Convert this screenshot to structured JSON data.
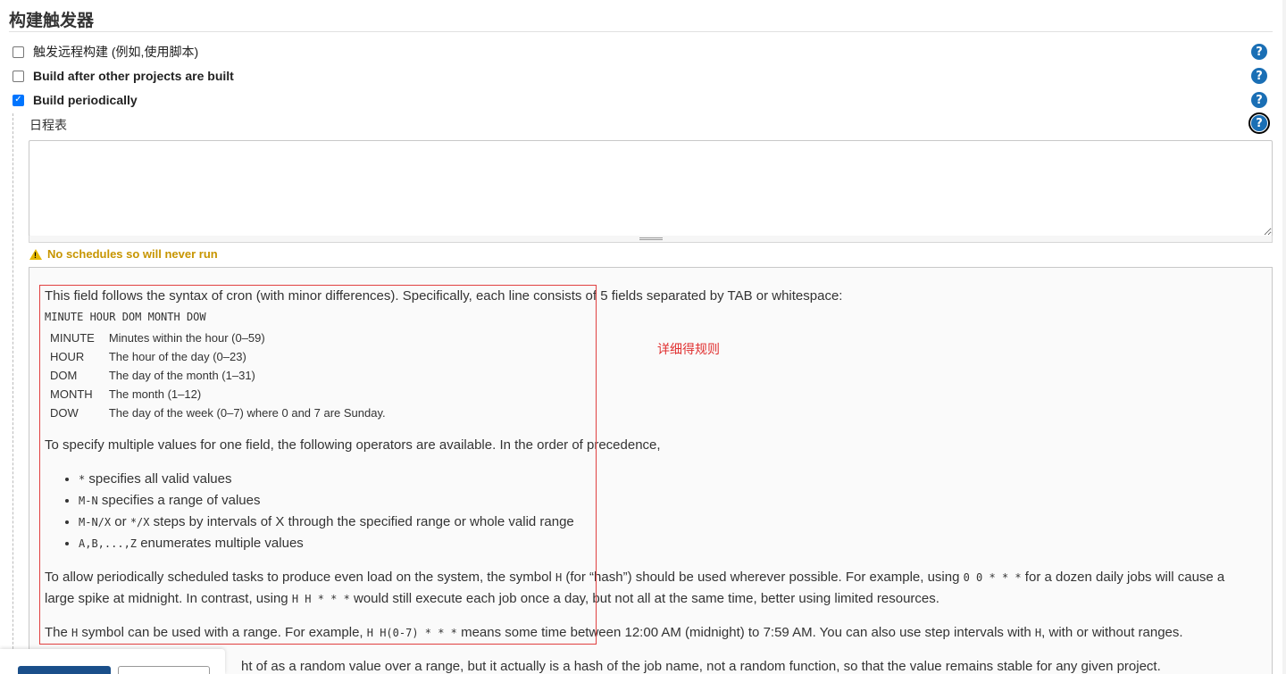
{
  "section": {
    "title": "构建触发器"
  },
  "triggers": [
    {
      "label": "触发远程构建 (例如,使用脚本)",
      "checked": false,
      "help_icon": "question-circle-icon"
    },
    {
      "label": "Build after other projects are built",
      "checked": false,
      "help_icon": "question-circle-icon"
    },
    {
      "label": "Build periodically",
      "checked": true,
      "help_icon": "question-circle-icon"
    }
  ],
  "schedule": {
    "label": "日程表",
    "value": "",
    "help_icon": "question-circle-icon"
  },
  "warning": {
    "icon": "warning-triangle-icon",
    "text": "No schedules so will never run"
  },
  "help": {
    "intro": "This field follows the syntax of cron (with minor differences). Specifically, each line consists of 5 fields separated by TAB or whitespace:",
    "format": "MINUTE HOUR DOM MONTH DOW",
    "fields": [
      {
        "name": "MINUTE",
        "desc": "Minutes within the hour (0–59)"
      },
      {
        "name": "HOUR",
        "desc": "The hour of the day (0–23)"
      },
      {
        "name": "DOM",
        "desc": "The day of the month (1–31)"
      },
      {
        "name": "MONTH",
        "desc": "The month (1–12)"
      },
      {
        "name": "DOW",
        "desc": "The day of the week (0–7) where 0 and 7 are Sunday."
      }
    ],
    "operators_intro": "To specify multiple values for one field, the following operators are available. In the order of precedence,",
    "operators": [
      {
        "code": "*",
        "text": " specifies all valid values"
      },
      {
        "code": "M-N",
        "text": " specifies a range of values"
      },
      {
        "code": "M-N/X",
        "mid": " or ",
        "code2": "*/X",
        "text": " steps by intervals of X through the specified range or whole valid range"
      },
      {
        "code": "A,B,...,Z",
        "text": " enumerates multiple values"
      }
    ],
    "hash_p1": "To allow periodically scheduled tasks to produce even load on the system, the symbol ",
    "hash_p1_code1": "H",
    "hash_p1_b": " (for “hash”) should be used wherever possible. For example, using ",
    "hash_p1_code2": "0 0 * * *",
    "hash_p1_c": " for a dozen daily jobs will cause a large spike at midnight. In contrast, using ",
    "hash_p1_code3": "H H * * *",
    "hash_p1_d": " would still execute each job once a day, but not all at the same time, better using limited resources.",
    "hash_p2_a": "The ",
    "hash_p2_code1": "H",
    "hash_p2_b": " symbol can be used with a range. For example, ",
    "hash_p2_code2": "H H(0-7) * * *",
    "hash_p2_c": " means some time between 12:00 AM (midnight) to 7:59 AM. You can also use step intervals with ",
    "hash_p2_code3": "H",
    "hash_p2_d": ", with or without ranges.",
    "hash_p3": "ht of as a random value over a range, but it actually is a hash of the job name, not a random function, so that the value remains stable for any given project."
  },
  "annotation": {
    "note": "详细得规则",
    "color": "#e03030"
  }
}
